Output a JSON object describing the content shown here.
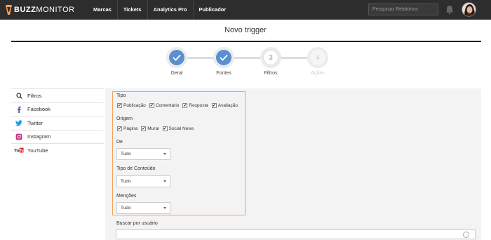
{
  "brand": {
    "name_bold": "BUZZ",
    "name_rest": "MONITOR",
    "accent": "#f0a35e"
  },
  "nav": [
    "Marcas",
    "Tickets",
    "Analytics Pro",
    "Publicador"
  ],
  "search": {
    "placeholder": "Pesquisar Relatórios"
  },
  "icons": {
    "bell": "bell-icon",
    "avatar": "user-avatar"
  },
  "page": {
    "title": "Novo trigger"
  },
  "steps": [
    {
      "label": "Geral",
      "state": "done"
    },
    {
      "label": "Fontes",
      "state": "done"
    },
    {
      "label": "Filtros",
      "state": "current",
      "number": "3"
    },
    {
      "label": "Ações",
      "state": "disabled",
      "number": "4"
    }
  ],
  "sidebar": {
    "items": [
      {
        "label": "Filtros",
        "icon": "search-icon"
      },
      {
        "label": "Facebook",
        "icon": "facebook-icon"
      },
      {
        "label": "Twitter",
        "icon": "twitter-icon"
      },
      {
        "label": "Instagram",
        "icon": "instagram-icon"
      },
      {
        "label": "YouTube",
        "icon": "youtube-icon"
      }
    ]
  },
  "filters": {
    "tipo": {
      "label": "Tipo",
      "options": [
        "Publicação",
        "Comentário",
        "Resposta",
        "Avaliação"
      ]
    },
    "origem": {
      "label": "Origem",
      "options": [
        "Página",
        "Mural",
        "Social News"
      ]
    },
    "de": {
      "label": "De",
      "value": "Tudo"
    },
    "tipo_conteudo": {
      "label": "Tipo de Conteúdo",
      "value": "Tudo"
    },
    "mencoes": {
      "label": "Menções",
      "value": "Tudo"
    }
  },
  "buscar_usuario": {
    "label": "Buscar por usuário"
  }
}
